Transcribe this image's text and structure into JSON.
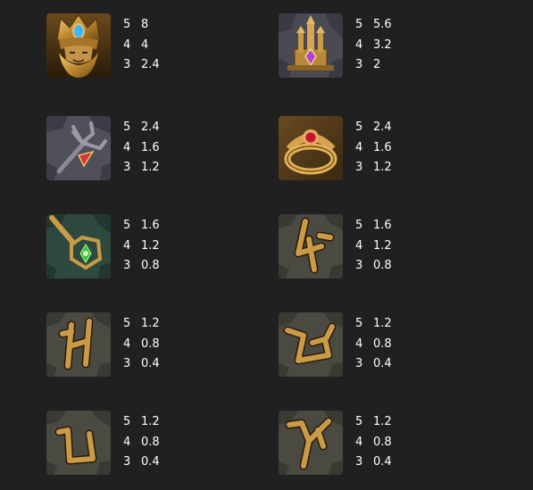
{
  "paytable": {
    "entries": [
      {
        "icon": "king-crown-face-icon",
        "pays": [
          {
            "count": "5",
            "value": "8"
          },
          {
            "count": "4",
            "value": "4"
          },
          {
            "count": "3",
            "value": "2.4"
          }
        ]
      },
      {
        "icon": "crystal-castle-icon",
        "pays": [
          {
            "count": "5",
            "value": "5.6"
          },
          {
            "count": "4",
            "value": "3.2"
          },
          {
            "count": "3",
            "value": "2"
          }
        ]
      },
      {
        "icon": "trident-stone-icon",
        "pays": [
          {
            "count": "5",
            "value": "2.4"
          },
          {
            "count": "4",
            "value": "1.6"
          },
          {
            "count": "3",
            "value": "1.2"
          }
        ]
      },
      {
        "icon": "ruby-ring-icon",
        "pays": [
          {
            "count": "5",
            "value": "2.4"
          },
          {
            "count": "4",
            "value": "1.6"
          },
          {
            "count": "3",
            "value": "1.2"
          }
        ]
      },
      {
        "icon": "emerald-staff-icon",
        "pays": [
          {
            "count": "5",
            "value": "1.6"
          },
          {
            "count": "4",
            "value": "1.2"
          },
          {
            "count": "3",
            "value": "0.8"
          }
        ]
      },
      {
        "icon": "rune-a-stone-icon",
        "pays": [
          {
            "count": "5",
            "value": "1.6"
          },
          {
            "count": "4",
            "value": "1.2"
          },
          {
            "count": "3",
            "value": "0.8"
          }
        ]
      },
      {
        "icon": "rune-h-stone-icon",
        "pays": [
          {
            "count": "5",
            "value": "1.2"
          },
          {
            "count": "4",
            "value": "0.8"
          },
          {
            "count": "3",
            "value": "0.4"
          }
        ]
      },
      {
        "icon": "rune-bowl-stone-icon",
        "pays": [
          {
            "count": "5",
            "value": "1.2"
          },
          {
            "count": "4",
            "value": "0.8"
          },
          {
            "count": "3",
            "value": "0.4"
          }
        ]
      },
      {
        "icon": "rune-u-stone-icon",
        "pays": [
          {
            "count": "5",
            "value": "1.2"
          },
          {
            "count": "4",
            "value": "0.8"
          },
          {
            "count": "3",
            "value": "0.4"
          }
        ]
      },
      {
        "icon": "rune-y-stone-icon",
        "pays": [
          {
            "count": "5",
            "value": "1.2"
          },
          {
            "count": "4",
            "value": "0.8"
          },
          {
            "count": "3",
            "value": "0.4"
          }
        ]
      }
    ]
  },
  "colors": {
    "background": "#202020",
    "text": "#ffffff",
    "gold": "#c9963e",
    "stone": "#4a4a44"
  }
}
